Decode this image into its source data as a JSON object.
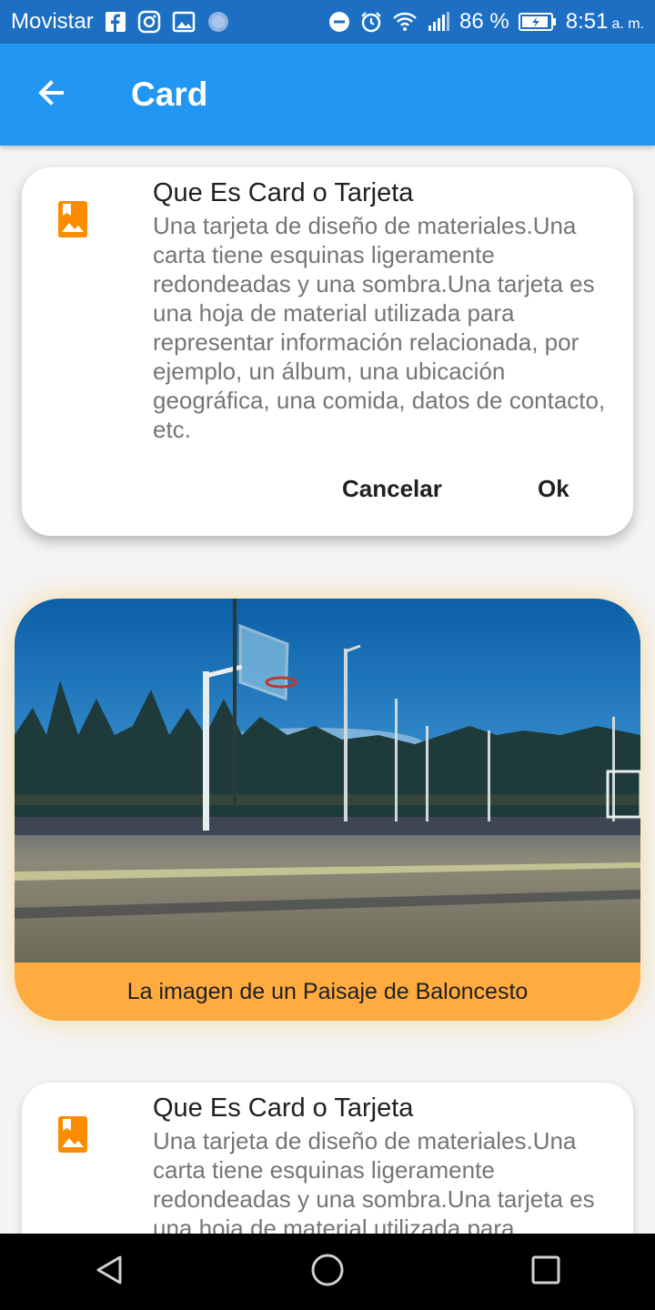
{
  "status_bar": {
    "carrier": "Movistar",
    "battery": "86 %",
    "time": "8:51",
    "ampm": "a. m.",
    "icons": [
      "facebook-icon",
      "instagram-icon",
      "image-icon",
      "blur-circle-icon",
      "dnd-icon",
      "alarm-icon",
      "wifi-icon",
      "signal-icon",
      "battery-icon"
    ]
  },
  "app_bar": {
    "title": "Card",
    "back_icon": "arrow-back-icon",
    "color": "#2196f3"
  },
  "cards": [
    {
      "title": "Que Es Card o Tarjeta",
      "subtitle": "Una tarjeta de diseño de materiales.Una carta tiene esquinas ligeramente redondeadas y una sombra.Una tarjeta es una hoja de material utilizada para representar información relacionada, por ejemplo, un álbum, una ubicación geográfica, una comida, datos de contacto, etc.",
      "icon": "photo-album-icon",
      "actions": {
        "cancel": "Cancelar",
        "ok": "Ok"
      }
    },
    {
      "caption": "La imagen de un Paisaje de Baloncesto",
      "accent": "#ffab40"
    },
    {
      "title": "Que Es Card o Tarjeta",
      "subtitle": "Una tarjeta de diseño de materiales.Una carta tiene esquinas ligeramente redondeadas y una sombra.Una tarjeta es una hoja de material utilizada para representar información relacionada, por ejemplo, un álbum, una ubicación geográfica, una comida, datos de contacto, etc.",
      "icon": "photo-album-icon"
    }
  ],
  "nav_bar": {
    "icons": [
      "back-triangle-icon",
      "home-circle-icon",
      "recents-square-icon"
    ]
  }
}
